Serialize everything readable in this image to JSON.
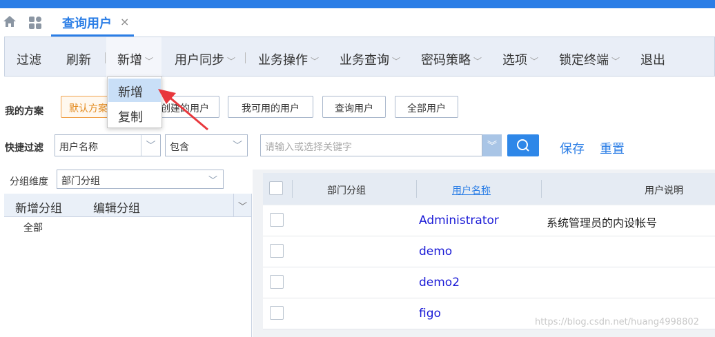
{
  "tab": {
    "title": "查询用户",
    "close": "×"
  },
  "toolbar": {
    "filter": "过滤",
    "refresh": "刷新",
    "add": "新增",
    "sync": "用户同步",
    "biz_op": "业务操作",
    "biz_query": "业务查询",
    "pwd_policy": "密码策略",
    "options": "选项",
    "lock": "锁定终端",
    "exit": "退出"
  },
  "dropdown": {
    "items": [
      "新增",
      "复制"
    ]
  },
  "scheme": {
    "label": "我的方案",
    "buttons": [
      "默认方案",
      "创建的用户",
      "我可用的用户",
      "查询用户",
      "全部用户"
    ]
  },
  "quick_filter": {
    "label": "快捷过滤",
    "field": "用户名称",
    "operator": "包含",
    "placeholder": "请输入或选择关键字",
    "save": "保存",
    "reset": "重置"
  },
  "group": {
    "label": "分组维度",
    "value": "部门分组",
    "add": "新增分组",
    "edit": "编辑分组",
    "tree": [
      "全部"
    ]
  },
  "grid": {
    "columns": [
      "部门分组",
      "用户名称",
      "用户说明"
    ],
    "rows": [
      {
        "dept": "",
        "name": "Administrator",
        "desc": "系统管理员的内设帐号"
      },
      {
        "dept": "",
        "name": "demo",
        "desc": ""
      },
      {
        "dept": "",
        "name": "demo2",
        "desc": ""
      },
      {
        "dept": "",
        "name": "figo",
        "desc": ""
      }
    ]
  },
  "watermark": "https://blog.csdn.net/huang4998802",
  "colors": {
    "brand": "#2b7ee6",
    "accent_orange": "#e38a1e",
    "arrow": "#e8383d"
  }
}
